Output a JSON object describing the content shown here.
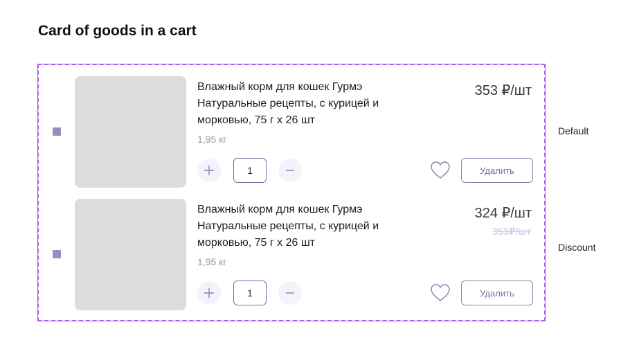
{
  "page": {
    "title": "Card of goods in a cart"
  },
  "cards": [
    {
      "state_label": "Default",
      "product_title": "Влажный корм для кошек Гурмэ Натуральные рецепты, с курицей и морковью, 75 г x 26 шт",
      "weight": "1,95 кг",
      "quantity": "1",
      "price": "353 ₽/шт",
      "old_price": "",
      "delete_label": "Удалить",
      "checkbox_checked": true
    },
    {
      "state_label": "Discount",
      "product_title": "Влажный корм для кошек Гурмэ Натуральные рецепты, с курицей и морковью, 75 г x 26 шт",
      "weight": "1,95 кг",
      "quantity": "1",
      "price": "324 ₽/шт",
      "old_price": "353₽/шт",
      "delete_label": "Удалить",
      "checkbox_checked": true
    }
  ],
  "colors": {
    "frame": "#a45bf0",
    "accent": "#7d6aa8",
    "checkbox": "#9b8dc0",
    "placeholder": "#dcdcdc"
  },
  "icons": {
    "plus": "plus-icon",
    "minus": "minus-icon",
    "favorite": "heart-icon"
  }
}
